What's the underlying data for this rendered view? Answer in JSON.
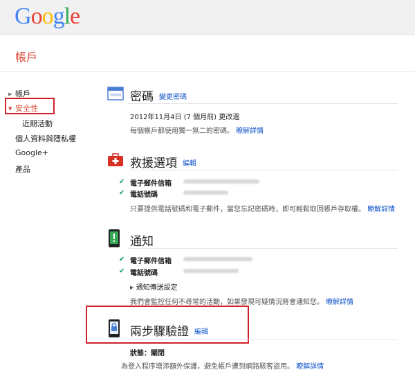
{
  "logo": {
    "text": "Google",
    "colors": [
      "#4285f4",
      "#ea4335",
      "#fbbc05",
      "#4285f4",
      "#34a853",
      "#ea4335"
    ]
  },
  "page": {
    "title": "帳戶"
  },
  "sidebar": {
    "items": [
      {
        "label": "帳戶",
        "arrow": "▶"
      },
      {
        "label": "安全性",
        "arrow": "▼"
      },
      {
        "label": "近期活動"
      },
      {
        "label": "個人資料與隱私權"
      },
      {
        "label": "Google+"
      },
      {
        "label": "產品"
      }
    ]
  },
  "password": {
    "title": "密碼",
    "link": "變更密碼",
    "changed": "2012年11月4日 (7 個月前) 更改過",
    "desc": "每個帳戶都使用獨一無二的密碼。",
    "learn_more": "瞭解詳情"
  },
  "recovery": {
    "title": "救援選項",
    "link": "編輯",
    "email_label": "電子郵件信箱",
    "phone_label": "電話號碼",
    "desc": "只要提供電話號碼和電子郵件，當您忘記密碼時，即可輕鬆取回帳戶存取權。",
    "learn_more": "瞭解詳情"
  },
  "notifications": {
    "title": "通知",
    "email_label": "電子郵件信箱",
    "phone_label": "電話號碼",
    "settings_link": "通知傳送設定",
    "settings_arrow": "▶",
    "desc": "我們會監控任何不尋常的活動，如果發現可疑情況將會通知您。",
    "learn_more": "瞭解詳情"
  },
  "two_step": {
    "title": "兩步驟驗證",
    "link": "編輯",
    "status": "狀態：關閉",
    "desc": "為登入程序增添額外保護，避免帳戶遭到網路駭客盜用。",
    "learn_more": "瞭解詳情"
  },
  "colors": {
    "accent_red": "#dd4b39",
    "link_blue": "#1155cc",
    "highlight": "#d0202a",
    "check_green": "#0f9d58"
  }
}
